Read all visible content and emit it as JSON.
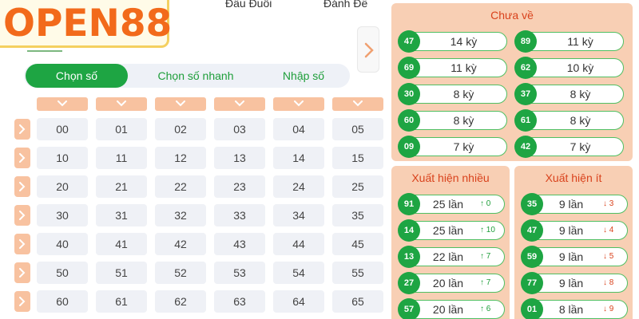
{
  "logo": {
    "text": "OPEN88"
  },
  "topnav": {
    "item1": "Đầu Đuôi",
    "item2": "Đánh Đề"
  },
  "tabs": [
    "Chọn số",
    "Chọn số nhanh",
    "Nhập số"
  ],
  "grid": [
    [
      "00",
      "01",
      "02",
      "03",
      "04",
      "05"
    ],
    [
      "10",
      "11",
      "12",
      "13",
      "14",
      "15"
    ],
    [
      "20",
      "21",
      "22",
      "23",
      "24",
      "25"
    ],
    [
      "30",
      "31",
      "32",
      "33",
      "34",
      "35"
    ],
    [
      "40",
      "41",
      "42",
      "43",
      "44",
      "45"
    ],
    [
      "50",
      "51",
      "52",
      "53",
      "54",
      "55"
    ],
    [
      "60",
      "61",
      "62",
      "63",
      "64",
      "65"
    ]
  ],
  "chua_ve": {
    "title": "Chưa về",
    "left": [
      {
        "num": "47",
        "text": "14 kỳ"
      },
      {
        "num": "69",
        "text": "11 kỳ"
      },
      {
        "num": "30",
        "text": "8 kỳ"
      },
      {
        "num": "60",
        "text": "8 kỳ"
      },
      {
        "num": "09",
        "text": "7 kỳ"
      }
    ],
    "right": [
      {
        "num": "89",
        "text": "11 kỳ"
      },
      {
        "num": "62",
        "text": "10 kỳ"
      },
      {
        "num": "37",
        "text": "8 kỳ"
      },
      {
        "num": "61",
        "text": "8 kỳ"
      },
      {
        "num": "42",
        "text": "7 kỳ"
      }
    ]
  },
  "xuat_hien_nhieu": {
    "title": "Xuất hiện nhiều",
    "items": [
      {
        "num": "91",
        "text": "25 lần",
        "trend": "↑ 0"
      },
      {
        "num": "14",
        "text": "25 lần",
        "trend": "↑ 10"
      },
      {
        "num": "13",
        "text": "22 lần",
        "trend": "↑ 7"
      },
      {
        "num": "27",
        "text": "20 lần",
        "trend": "↑ 7"
      },
      {
        "num": "57",
        "text": "20 lần",
        "trend": "↑ 6"
      }
    ]
  },
  "xuat_hien_it": {
    "title": "Xuất hiện ít",
    "items": [
      {
        "num": "35",
        "text": "9 lần",
        "trend": "↓ 3"
      },
      {
        "num": "47",
        "text": "9 lần",
        "trend": "↓ 4"
      },
      {
        "num": "59",
        "text": "9 lần",
        "trend": "↓ 5"
      },
      {
        "num": "77",
        "text": "9 lần",
        "trend": "↓ 8"
      },
      {
        "num": "01",
        "text": "8 lần",
        "trend": "↓ 9"
      }
    ]
  },
  "colors": {
    "green": "#1ea543",
    "peach": "#f8cfb4",
    "orange_red": "#d9421c",
    "logo_orange": "#f26a1b"
  }
}
